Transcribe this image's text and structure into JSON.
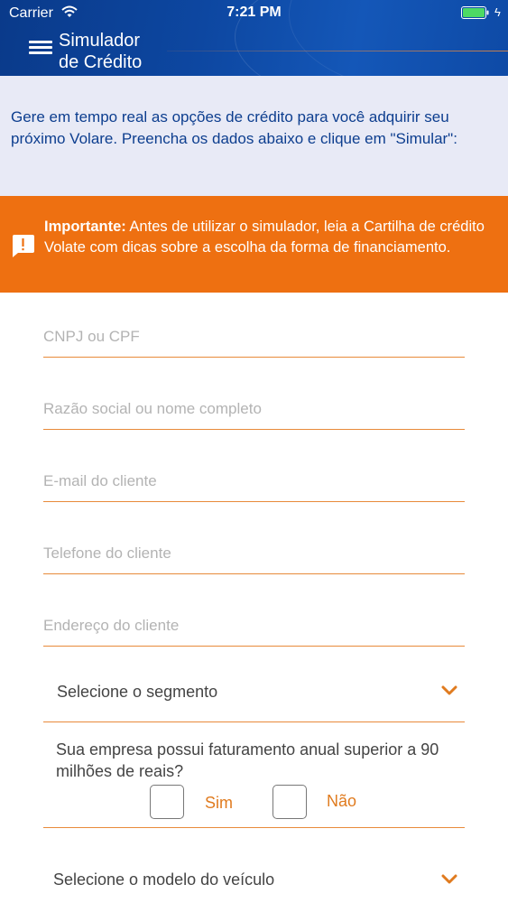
{
  "status_bar": {
    "carrier": "Carrier",
    "time": "7:21 PM"
  },
  "header": {
    "title_line1": "Simulador",
    "title_line2": "de Crédito"
  },
  "intro": {
    "text": "Gere em tempo real as opções de crédito para você adquirir seu próximo Volare. Preencha os dados abaixo e clique em \"Simular\":"
  },
  "notice": {
    "label": "Importante:",
    "text": " Antes de utilizar o simulador, leia a Cartilha de crédito Volate com dicas sobre a escolha da forma de financiamento."
  },
  "form": {
    "cnpj_placeholder": "CNPJ ou CPF",
    "name_placeholder": "Razão social ou nome completo",
    "email_placeholder": "E-mail do cliente",
    "phone_placeholder": "Telefone do cliente",
    "address_placeholder": "Endereço do cliente",
    "segment_select": "Selecione o segmento",
    "revenue_question": "Sua empresa possui faturamento anual superior a 90 milhões de reais?",
    "option_yes": "Sim",
    "option_no": "Não",
    "model_select": "Selecione o modelo do veículo"
  },
  "colors": {
    "header_blue": "#0d47a1",
    "accent_orange": "#ee7011",
    "intro_bg": "#e8eaf6",
    "intro_text": "#0d3e8f"
  }
}
